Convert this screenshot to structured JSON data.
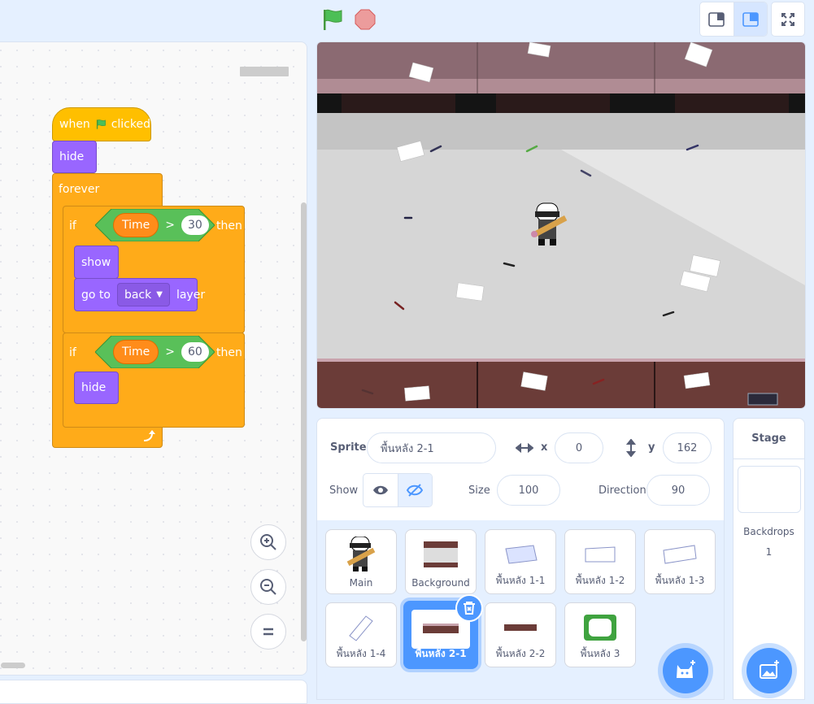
{
  "toolbar": {
    "green_flag": "green-flag-icon",
    "stop": "stop-icon",
    "layout_small": "small-stage-icon",
    "layout_normal": "normal-stage-icon",
    "fullscreen": "fullscreen-icon"
  },
  "script": {
    "hat_when": "when",
    "hat_clicked": "clicked",
    "hide1": "hide",
    "forever": "forever",
    "if1": {
      "if": "if",
      "var": "Time",
      "op": ">",
      "value": "30",
      "then": "then"
    },
    "show": "show",
    "goto": {
      "prefix": "go to",
      "option": "back",
      "suffix": "layer"
    },
    "if2": {
      "if": "if",
      "var": "Time",
      "op": ">",
      "value": "60",
      "then": "then"
    },
    "hide2": "hide"
  },
  "sprite_info": {
    "sprite_label": "Sprite",
    "sprite_name": "พื้นหลัง 2-1",
    "x_label": "x",
    "x_value": "0",
    "y_label": "y",
    "y_value": "162",
    "show_label": "Show",
    "size_label": "Size",
    "size_value": "100",
    "direction_label": "Direction",
    "direction_value": "90"
  },
  "sprites": [
    {
      "name": "Main"
    },
    {
      "name": "Background"
    },
    {
      "name": "พื้นหลัง 1-1"
    },
    {
      "name": "พื้นหลัง 1-2"
    },
    {
      "name": "พื้นหลัง 1-3"
    },
    {
      "name": "พื้นหลัง 1-4"
    },
    {
      "name": "พื้นหลัง 2-1"
    },
    {
      "name": "พื้นหลัง 2-2"
    },
    {
      "name": "พื้นหลัง 3"
    }
  ],
  "stage_panel": {
    "title": "Stage",
    "backdrops_label": "Backdrops",
    "backdrops_count": "1"
  },
  "colors": {
    "accent": "#4c97ff",
    "events": "#ffbf00",
    "looks": "#9966ff",
    "control": "#ffab19",
    "operators": "#59c059",
    "variables": "#ff8c1a"
  }
}
